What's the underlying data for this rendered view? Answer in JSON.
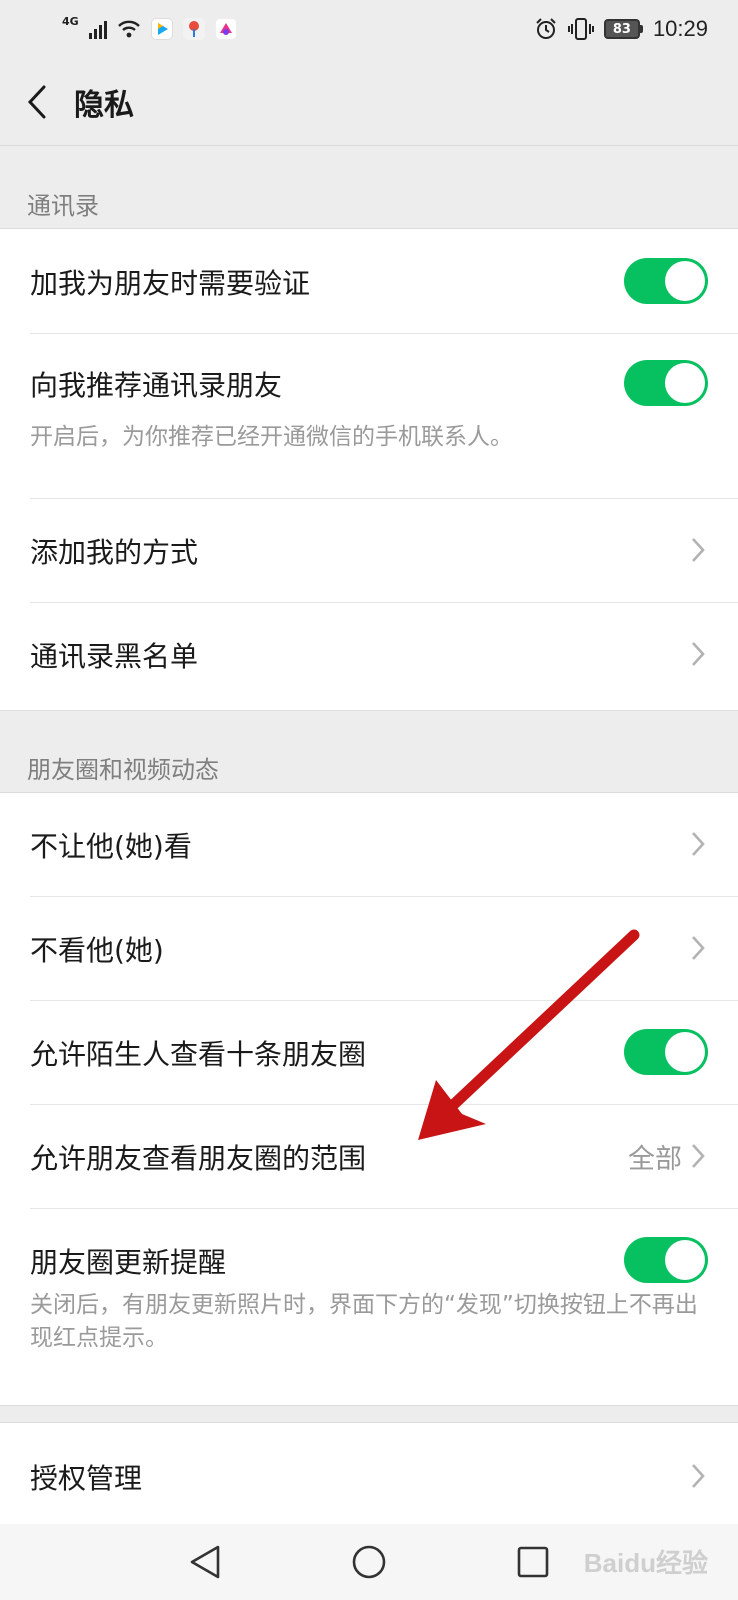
{
  "status_bar": {
    "network": "4G",
    "battery": "83",
    "time": "10:29"
  },
  "header": {
    "title": "隐私"
  },
  "sections": [
    {
      "header": "通讯录",
      "items": [
        {
          "label": "加我为朋友时需要验证",
          "type": "toggle",
          "on": true
        },
        {
          "label": "向我推荐通讯录朋友",
          "type": "toggle",
          "on": true,
          "description": "开启后，为你推荐已经开通微信的手机联系人。"
        },
        {
          "label": "添加我的方式",
          "type": "link"
        },
        {
          "label": "通讯录黑名单",
          "type": "link"
        }
      ]
    },
    {
      "header": "朋友圈和视频动态",
      "items": [
        {
          "label": "不让他(她)看",
          "type": "link"
        },
        {
          "label": "不看他(她)",
          "type": "link"
        },
        {
          "label": "允许陌生人查看十条朋友圈",
          "type": "toggle",
          "on": true
        },
        {
          "label": "允许朋友查看朋友圈的范围",
          "type": "link",
          "value": "全部"
        },
        {
          "label": "朋友圈更新提醒",
          "type": "toggle",
          "on": true,
          "description": "关闭后，有朋友更新照片时，界面下方的“发现”切换按钮上不再出现红点提示。"
        }
      ]
    },
    {
      "items": [
        {
          "label": "授权管理",
          "type": "link"
        }
      ]
    }
  ],
  "watermark": "Baidu经验",
  "colors": {
    "accent": "#07c160",
    "annotation": "#c81414",
    "background": "#ededed"
  }
}
